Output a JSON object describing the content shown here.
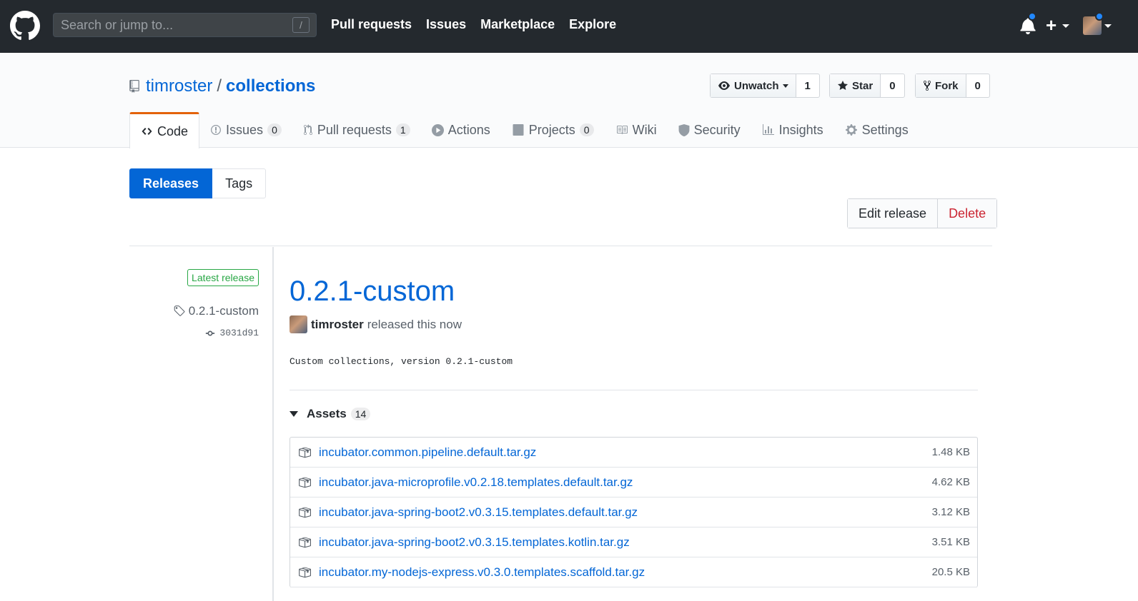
{
  "header": {
    "search_placeholder": "Search or jump to...",
    "search_shortcut": "/",
    "nav": [
      "Pull requests",
      "Issues",
      "Marketplace",
      "Explore"
    ],
    "plus_label": "+"
  },
  "repo": {
    "owner": "timroster",
    "separator": "/",
    "name": "collections",
    "watch_label": "Unwatch",
    "watch_count": "1",
    "star_label": "Star",
    "star_count": "0",
    "fork_label": "Fork",
    "fork_count": "0"
  },
  "tabs": [
    {
      "label": "Code",
      "counter": ""
    },
    {
      "label": "Issues",
      "counter": "0"
    },
    {
      "label": "Pull requests",
      "counter": "1"
    },
    {
      "label": "Actions",
      "counter": ""
    },
    {
      "label": "Projects",
      "counter": "0"
    },
    {
      "label": "Wiki",
      "counter": ""
    },
    {
      "label": "Security",
      "counter": ""
    },
    {
      "label": "Insights",
      "counter": ""
    },
    {
      "label": "Settings",
      "counter": ""
    }
  ],
  "subnav": {
    "releases": "Releases",
    "tags": "Tags"
  },
  "actions": {
    "edit": "Edit release",
    "delete": "Delete"
  },
  "release": {
    "latest_label": "Latest release",
    "tag": "0.2.1-custom",
    "commit": "3031d91",
    "title": "0.2.1-custom",
    "author": "timroster",
    "released_text": "released this now",
    "description": "Custom collections, version 0.2.1-custom",
    "assets_label": "Assets",
    "assets_count": "14",
    "assets": [
      {
        "name": "incubator.common.pipeline.default.tar.gz",
        "size": "1.48 KB"
      },
      {
        "name": "incubator.java-microprofile.v0.2.18.templates.default.tar.gz",
        "size": "4.62 KB"
      },
      {
        "name": "incubator.java-spring-boot2.v0.3.15.templates.default.tar.gz",
        "size": "3.12 KB"
      },
      {
        "name": "incubator.java-spring-boot2.v0.3.15.templates.kotlin.tar.gz",
        "size": "3.51 KB"
      },
      {
        "name": "incubator.my-nodejs-express.v0.3.0.templates.scaffold.tar.gz",
        "size": "20.5 KB"
      }
    ]
  },
  "colors": {
    "header_bg": "#24292e",
    "link": "#0366d6",
    "danger": "#cb2431",
    "success": "#28a745",
    "accent_tab": "#e36209"
  }
}
